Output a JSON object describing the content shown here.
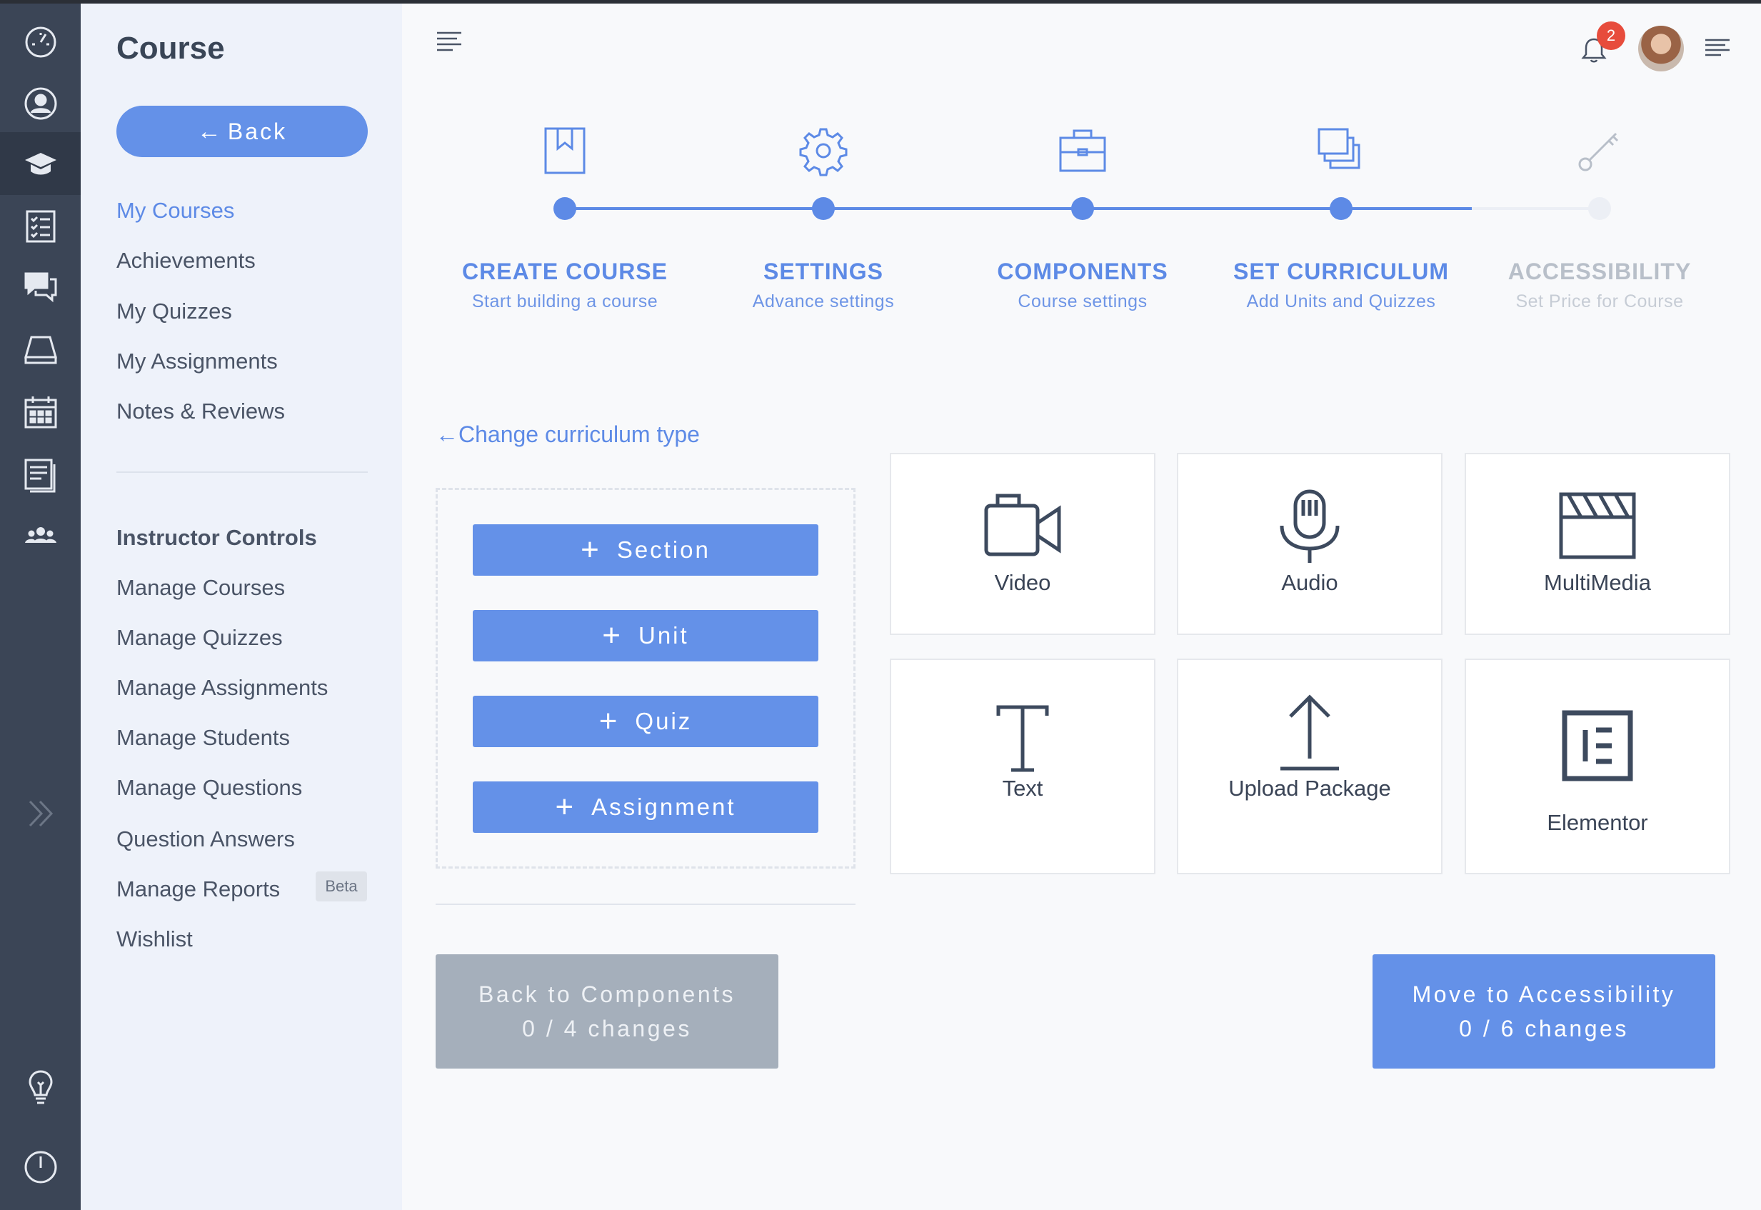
{
  "sidebar": {
    "title": "Course",
    "back_label": "Back",
    "nav": [
      "My Courses",
      "Achievements",
      "My Quizzes",
      "My Assignments",
      "Notes & Reviews"
    ],
    "instructor_heading": "Instructor Controls",
    "instructor_nav": [
      "Manage Courses",
      "Manage Quizzes",
      "Manage Assignments",
      "Manage Students",
      "Manage Questions",
      "Question Answers",
      "Manage Reports",
      "Wishlist"
    ],
    "beta_badge": "Beta"
  },
  "rail_icons": [
    "dashboard-icon",
    "profile-icon",
    "courses-icon",
    "quiz-list-icon",
    "messages-icon",
    "drive-icon",
    "calendar-icon",
    "notes-icon",
    "groups-icon",
    "expand-icon",
    "bulb-icon",
    "power-icon"
  ],
  "header": {
    "notification_count": "2"
  },
  "stepper": [
    {
      "title": "CREATE COURSE",
      "subtitle": "Start building a course",
      "done": true
    },
    {
      "title": "SETTINGS",
      "subtitle": "Advance settings",
      "done": true
    },
    {
      "title": "COMPONENTS",
      "subtitle": "Course settings",
      "done": true
    },
    {
      "title": "SET CURRICULUM",
      "subtitle": "Add Units and Quizzes",
      "done": true
    },
    {
      "title": "ACCESSIBILITY",
      "subtitle": "Set Price for Course",
      "done": false
    }
  ],
  "curriculum": {
    "change_link": "Change curriculum type",
    "add_buttons": [
      "Section",
      "Unit",
      "Quiz",
      "Assignment"
    ]
  },
  "unit_types": [
    "Video",
    "Audio",
    "MultiMedia",
    "Text",
    "Upload Package",
    "Elementor"
  ],
  "footer": {
    "back_title": "Back to Components",
    "back_changes": "0 / 4 changes",
    "next_title": "Move to Accessibility",
    "next_changes": "0 / 6 changes"
  },
  "colors": {
    "accent": "#6491e8",
    "rail_bg": "#3b4556",
    "sidebar_bg": "#eef2fa",
    "badge": "#e74c3c"
  }
}
